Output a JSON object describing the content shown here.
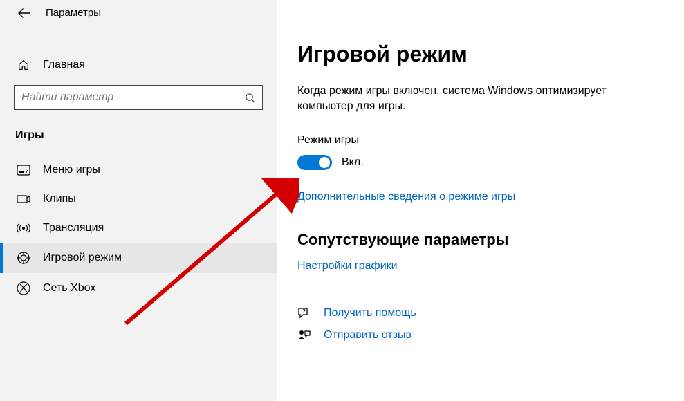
{
  "header": {
    "app_title": "Параметры"
  },
  "sidebar": {
    "home_label": "Главная",
    "search_placeholder": "Найти параметр",
    "category_label": "Игры",
    "items": [
      {
        "label": "Меню игры"
      },
      {
        "label": "Клипы"
      },
      {
        "label": "Трансляция"
      },
      {
        "label": "Игровой режим"
      },
      {
        "label": "Сеть Xbox"
      }
    ]
  },
  "main": {
    "title": "Игровой режим",
    "description": "Когда режим игры включен, система Windows оптимизирует компьютер для игры.",
    "toggle_label": "Режим игры",
    "toggle_state": "Вкл.",
    "link_learn_more": "Дополнительные сведения о режиме игры",
    "related_heading": "Сопутствующие параметры",
    "link_graphics": "Настройки графики",
    "link_help": "Получить помощь",
    "link_feedback": "Отправить отзыв"
  }
}
